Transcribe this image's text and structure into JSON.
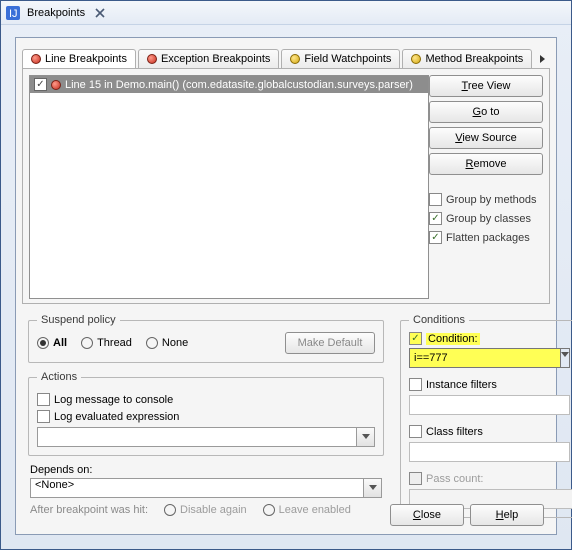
{
  "window": {
    "title": "Breakpoints"
  },
  "tabs": [
    {
      "label": "Line Breakpoints",
      "icon": "red"
    },
    {
      "label": "Exception Breakpoints",
      "icon": "red"
    },
    {
      "label": "Field Watchpoints",
      "icon": "yellow"
    },
    {
      "label": "Method Breakpoints",
      "icon": "yellow"
    }
  ],
  "breakpoints": [
    {
      "checked": true,
      "label": "Line 15 in Demo.main() (com.edatasite.globalcustodian.surveys.parser)"
    }
  ],
  "side_buttons": {
    "tree_view": "Tree View",
    "go_to": "Go to",
    "view_source": "View Source",
    "remove": "Remove"
  },
  "side_checks": {
    "group_methods": {
      "label": "Group by methods",
      "checked": false
    },
    "group_classes": {
      "label": "Group by classes",
      "checked": true
    },
    "flatten": {
      "label": "Flatten packages",
      "checked": true
    }
  },
  "suspend": {
    "legend": "Suspend policy",
    "all": "All",
    "thread": "Thread",
    "none": "None",
    "selected": "all",
    "make_default": "Make Default"
  },
  "actions": {
    "legend": "Actions",
    "log_console": "Log message to console",
    "log_expr": "Log evaluated expression",
    "expr_value": ""
  },
  "depends": {
    "label": "Depends on:",
    "value": "<None>",
    "after_label": "After breakpoint was hit:",
    "disable_again": "Disable again",
    "leave_enabled": "Leave enabled"
  },
  "conditions": {
    "legend": "Conditions",
    "condition_label": "Condition:",
    "condition_checked": true,
    "condition_value": "i==777",
    "instance_label": "Instance filters",
    "class_label": "Class filters",
    "pass_label": "Pass count:"
  },
  "footer": {
    "close": "Close",
    "help": "Help"
  },
  "ellipsis": "..."
}
